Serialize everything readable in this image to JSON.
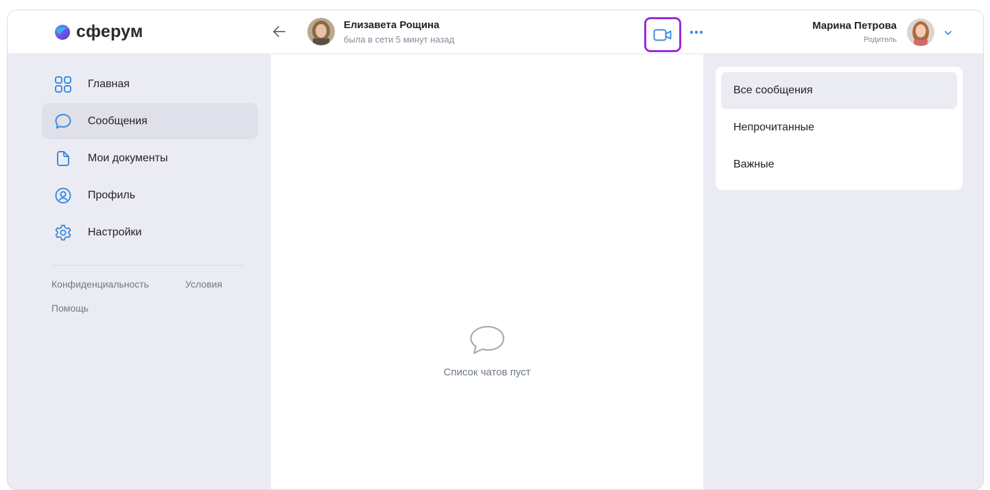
{
  "app": {
    "logo_text": "сферум"
  },
  "chat_header": {
    "contact_name": "Елизавета Рощина",
    "contact_status": "была в сети 5 минут назад"
  },
  "user": {
    "name": "Марина Петрова",
    "role": "Родитель"
  },
  "sidebar": {
    "items": [
      {
        "label": "Главная",
        "icon": "grid-icon",
        "active": false
      },
      {
        "label": "Сообщения",
        "icon": "chat-bubble-icon",
        "active": true
      },
      {
        "label": "Мои документы",
        "icon": "document-icon",
        "active": false
      },
      {
        "label": "Профиль",
        "icon": "user-circle-icon",
        "active": false
      },
      {
        "label": "Настройки",
        "icon": "gear-icon",
        "active": false
      }
    ],
    "footer_links": [
      "Конфиденциальность",
      "Условия",
      "Помощь"
    ]
  },
  "main": {
    "empty_text": "Список чатов пуст"
  },
  "filters": {
    "items": [
      {
        "label": "Все сообщения",
        "active": true
      },
      {
        "label": "Непрочитанные",
        "active": false
      },
      {
        "label": "Важные",
        "active": false
      }
    ]
  },
  "colors": {
    "accent_highlight": "#9b2bd8",
    "icon_accent": "#3f8ae0",
    "sidebar_bg": "#ebecf3",
    "active_item_bg": "#dfe0ea"
  }
}
